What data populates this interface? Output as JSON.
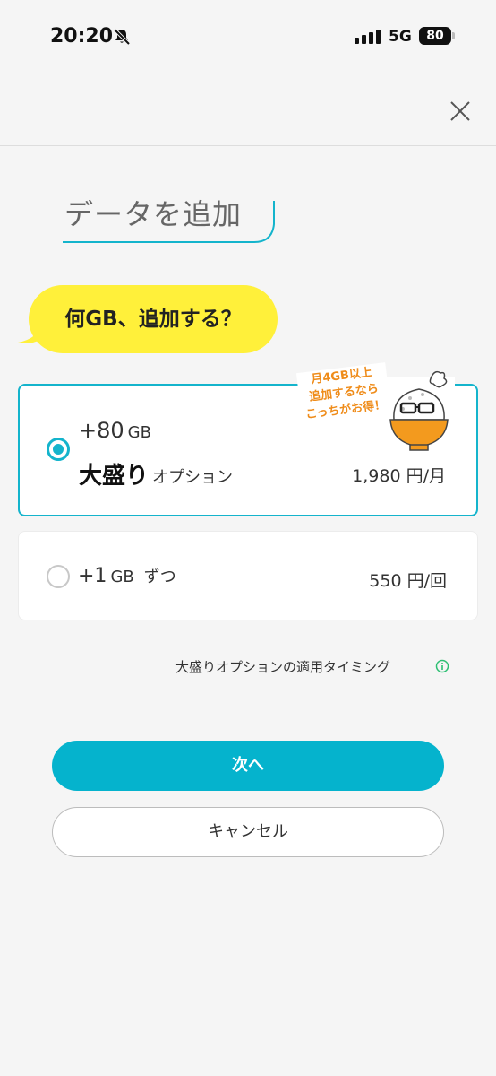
{
  "status_bar": {
    "time": "20:20",
    "network": "5G",
    "battery": "80"
  },
  "header": {
    "title": "データを追加"
  },
  "prompt": {
    "question": "何GB、追加する？"
  },
  "options": {
    "omori": {
      "amount": "+80",
      "unit": "GB",
      "name": "大盛り",
      "name_suffix": "オプション",
      "price": "1,980 円/月",
      "selected": true,
      "promo_lines": [
        "月4GB以上",
        "追加するなら",
        "こっちがお得！"
      ]
    },
    "per_gb": {
      "amount": "+1",
      "unit": "GB",
      "suffix": "ずつ",
      "price": "550 円/回",
      "selected": false
    }
  },
  "timing_link": "大盛りオプションの適用タイミング",
  "buttons": {
    "next": "次へ",
    "cancel": "キャンセル"
  },
  "colors": {
    "accent": "#05b3cd",
    "bubble": "#fff03a",
    "promo": "#ef8c1a",
    "info_icon": "#2dbf73"
  }
}
